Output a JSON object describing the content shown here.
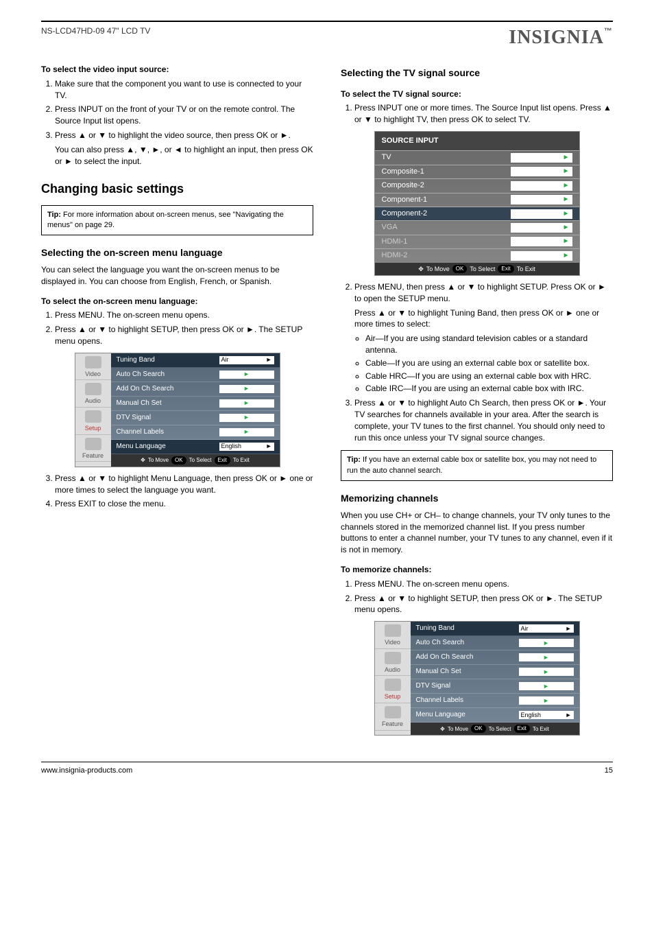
{
  "doc": {
    "brand_name": "INSIGNIA",
    "brand_tm": "™",
    "model_header": "NS-LCD47HD-09 47\" LCD TV",
    "footer_url": "www.insignia-products.com",
    "footer_page": "15"
  },
  "left": {
    "intro_heading": "To select the video input source:",
    "steps1": [
      "Make sure that the component you want to use is connected to your TV.",
      "Press INPUT on the front of your TV or on the remote control. The Source Input list opens.",
      "Press ▲ or ▼ to highlight the video source, then press OK or ►."
    ],
    "steps1_sub": "You can also press ▲, ▼, ►, or ◄ to highlight an input, then press OK or ► to select the input.",
    "cb_title": "Changing basic settings",
    "tip1_label": "Tip:",
    "tip1_text": "For more information about on-screen menus, see \"Navigating the menus\" on page 29.",
    "menulang_title": "Selecting the on-screen menu language",
    "menulang_intro": "You can select the language you want the on-screen menus to be displayed in. You can choose from English, French, or Spanish.",
    "menulang_heading": "To select the on-screen menu language:",
    "steps2": [
      "Press MENU. The on-screen menu opens.",
      "Press ▲ or ▼ to highlight SETUP, then press OK or ►. The SETUP menu opens."
    ],
    "setup": {
      "nav": [
        "Video",
        "Audio",
        "Setup",
        "Feature"
      ],
      "rows": [
        {
          "label": "Tuning Band",
          "value": "Air"
        },
        {
          "label": "Auto Ch Search",
          "value": ""
        },
        {
          "label": "Add On Ch Search",
          "value": ""
        },
        {
          "label": "Manual Ch Set",
          "value": ""
        },
        {
          "label": "DTV Signal",
          "value": ""
        },
        {
          "label": "Channel Labels",
          "value": ""
        },
        {
          "label": "Menu Language",
          "value": "English"
        }
      ],
      "footer": "To Move   OK   To Select   Exit   To Exit"
    },
    "steps3": [
      "Press ▲ or ▼ to highlight Menu Language, then press OK or ► one or more times to select the language you want.",
      "Press EXIT to close the menu."
    ]
  },
  "right": {
    "src_heading": "Selecting the TV signal source",
    "src_steps_intro": "To select the TV signal source:",
    "src_step1": "Press INPUT one or more times. The Source Input list opens. Press ▲ or ▼ to highlight TV, then press OK to select TV.",
    "source_panel": {
      "title": "SOURCE INPUT",
      "items": [
        "TV",
        "Composite-1",
        "Composite-2",
        "Component-1",
        "Component-2",
        "VGA",
        "HDMI-1",
        "HDMI-2"
      ],
      "footer": "To Move   OK   To Select   Exit   To Exit"
    },
    "src_step2_lead": "Press MENU, then press ▲ or ▼ to highlight SETUP. Press OK or ► to open the SETUP menu.",
    "src_step2_sub": "Press ▲ or ▼ to highlight Tuning Band, then press OK or ► one or more times to select:",
    "band_options": [
      "Air—If you are using standard television cables or a standard antenna.",
      "Cable—If you are using an external cable box or satellite box.",
      "Cable HRC—If you are using an external cable box with HRC.",
      "Cable IRC—If you are using an external cable box with IRC."
    ],
    "src_step3": "Press ▲ or ▼ to highlight Auto Ch Search, then press OK or ►. Your TV searches for channels available in your area. After the search is complete, your TV tunes to the first channel. You should only need to run this once unless your TV signal source changes.",
    "tip2_label": "Tip:",
    "tip2_text": "If you have an external cable box or satellite box, you may not need to run the auto channel search.",
    "mem_title": "Memorizing channels",
    "mem_intro": "When you use CH+ or CH– to change channels, your TV only tunes to the channels stored in the memorized channel list. If you press number buttons to enter a channel number, your TV tunes to any channel, even if it is not in memory.",
    "mem_heading": "To memorize channels:",
    "mem_step1": "Press MENU. The on-screen menu opens.",
    "mem_step2": "Press ▲ or ▼ to highlight SETUP, then press OK or ►. The SETUP menu opens.",
    "setup2": {
      "nav": [
        "Video",
        "Audio",
        "Setup",
        "Feature"
      ],
      "rows": [
        {
          "label": "Tuning Band",
          "value": "Air"
        },
        {
          "label": "Auto Ch Search",
          "value": ""
        },
        {
          "label": "Add On Ch Search",
          "value": ""
        },
        {
          "label": "Manual Ch Set",
          "value": ""
        },
        {
          "label": "DTV Signal",
          "value": ""
        },
        {
          "label": "Channel Labels",
          "value": ""
        },
        {
          "label": "Menu Language",
          "value": "English"
        }
      ],
      "footer": "To Move   OK   To Select   Exit   To Exit"
    }
  },
  "osd": {
    "move": "To Move",
    "ok": "OK",
    "select": "To Select",
    "exit_pill": "Exit",
    "exit": "To Exit"
  }
}
